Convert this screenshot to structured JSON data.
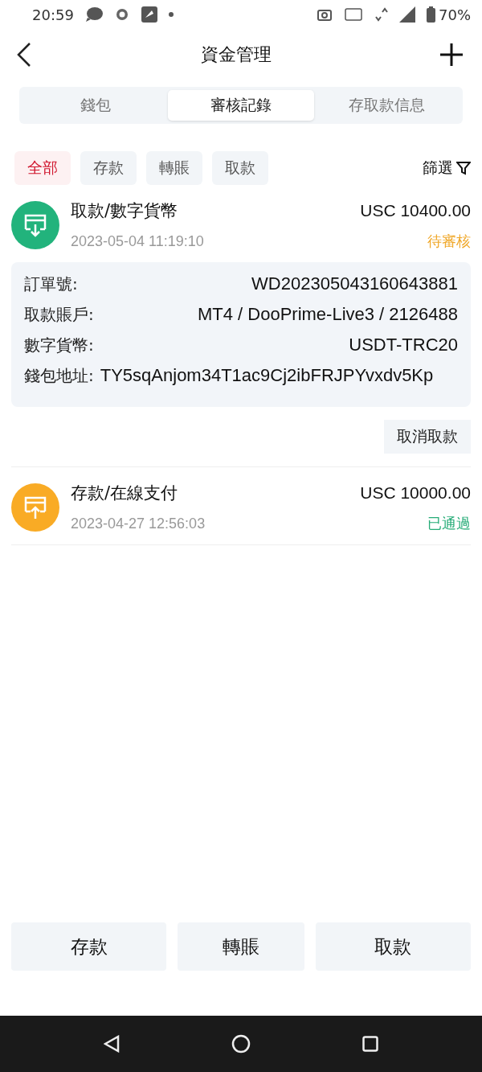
{
  "status_bar": {
    "time": "20:59",
    "battery": "70%"
  },
  "header": {
    "title": "資金管理"
  },
  "tabs": [
    {
      "label": "錢包",
      "selected": false
    },
    {
      "label": "審核記錄",
      "selected": true
    },
    {
      "label": "存取款信息",
      "selected": false
    }
  ],
  "filters": [
    {
      "label": "全部",
      "selected": true
    },
    {
      "label": "存款",
      "selected": false
    },
    {
      "label": "轉賬",
      "selected": false
    },
    {
      "label": "取款",
      "selected": false
    }
  ],
  "filter_button": "篩選",
  "records": [
    {
      "kind": "withdraw",
      "title": "取款/數字貨幣",
      "time": "2023-05-04 11:19:10",
      "amount": "USC 10400.00",
      "status": {
        "text": "待審核",
        "color": "#f0a82a"
      },
      "details": [
        {
          "label": "訂單號:",
          "value": "WD202305043160643881"
        },
        {
          "label": "取款賬戶:",
          "value": "MT4 / DooPrime-Live3 / 2126488"
        },
        {
          "label": "數字貨幣:",
          "value": "USDT-TRC20"
        },
        {
          "label": "錢包地址:",
          "value": "TY5sqAnjom34T1ac9Cj2ibFRJPYvxdv5Kp",
          "kind": "wrap"
        }
      ],
      "action": "取消取款"
    },
    {
      "kind": "deposit",
      "title": "存款/在線支付",
      "time": "2023-04-27 12:56:03",
      "amount": "USC 10000.00",
      "status": {
        "text": "已通過",
        "color": "#27ac78"
      }
    }
  ],
  "bottom_buttons": [
    "存款",
    "轉賬",
    "取款"
  ]
}
